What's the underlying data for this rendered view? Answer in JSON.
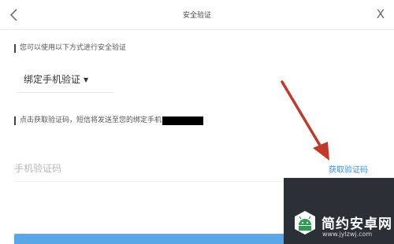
{
  "header": {
    "title": "安全验证",
    "back_icon": "chevron-left-icon",
    "close_label": "X"
  },
  "section_1": {
    "label": "您可以使用以下方式进行安全验证"
  },
  "method": {
    "selected": "绑定手机验证",
    "caret": "▼"
  },
  "section_2": {
    "label": "点击获取验证码，短信将发送至您的绑定手机"
  },
  "code_field": {
    "placeholder": "手机验证码",
    "value": ""
  },
  "get_code": {
    "label": "获取验证码"
  },
  "watermark": {
    "name": "简约安卓网",
    "domain": "www.jylzwj.com"
  },
  "colors": {
    "link": "#3a8ee6",
    "button": "#5aa7e8",
    "arrow": "#c0392b",
    "watermark_bg": "#2b3036"
  }
}
